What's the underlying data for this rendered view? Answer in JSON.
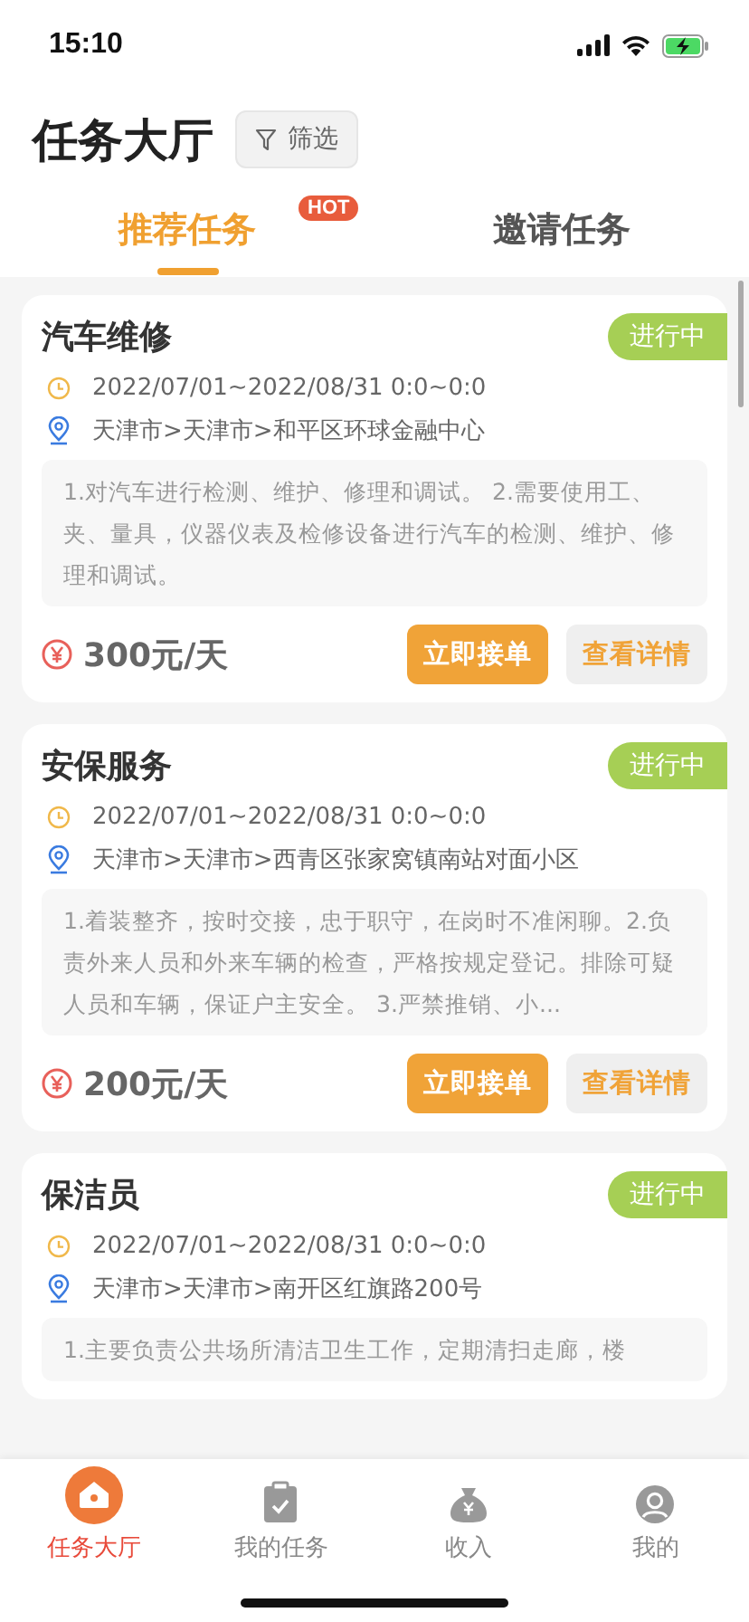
{
  "status_bar": {
    "time": "15:10"
  },
  "header": {
    "title": "任务大厅",
    "filter_button": "筛选"
  },
  "tabs": [
    {
      "label": "推荐任务",
      "selected": true,
      "badge": "HOT"
    },
    {
      "label": "邀请任务",
      "selected": false
    }
  ],
  "tasks": [
    {
      "title": "汽车维修",
      "status": "进行中",
      "date": "2022/07/01~2022/08/31 0:0~0:0",
      "address": "天津市>天津市>和平区环球金融中心",
      "description": "1.对汽车进行检测、维护、修理和调试。 2.需要使用工、夹、量具，仪器仪表及检修设备进行汽车的检测、维护、修理和调试。",
      "price": "300元/天",
      "accept_button": "立即接单",
      "details_button": "查看详情"
    },
    {
      "title": "安保服务",
      "status": "进行中",
      "date": "2022/07/01~2022/08/31 0:0~0:0",
      "address": "天津市>天津市>西青区张家窝镇南站对面小区",
      "description": "1.着装整齐，按时交接，忠于职守，在岗时不准闲聊。2.负责外来人员和外来车辆的检查，严格按规定登记。排除可疑人员和车辆，保证户主安全。 3.严禁推销、小...",
      "price": "200元/天",
      "accept_button": "立即接单",
      "details_button": "查看详情"
    },
    {
      "title": "保洁员",
      "status": "进行中",
      "date": "2022/07/01~2022/08/31 0:0~0:0",
      "address": "天津市>天津市>南开区红旗路200号",
      "description": "1.主要负责公共场所清洁卫生工作，定期清扫走廊，楼"
    }
  ],
  "bottom_nav": [
    {
      "label": "任务大厅",
      "selected": true,
      "kind": "home"
    },
    {
      "label": "我的任务",
      "selected": false,
      "kind": "tasks"
    },
    {
      "label": "收入",
      "selected": false,
      "kind": "income"
    },
    {
      "label": "我的",
      "selected": false,
      "kind": "profile"
    }
  ]
}
